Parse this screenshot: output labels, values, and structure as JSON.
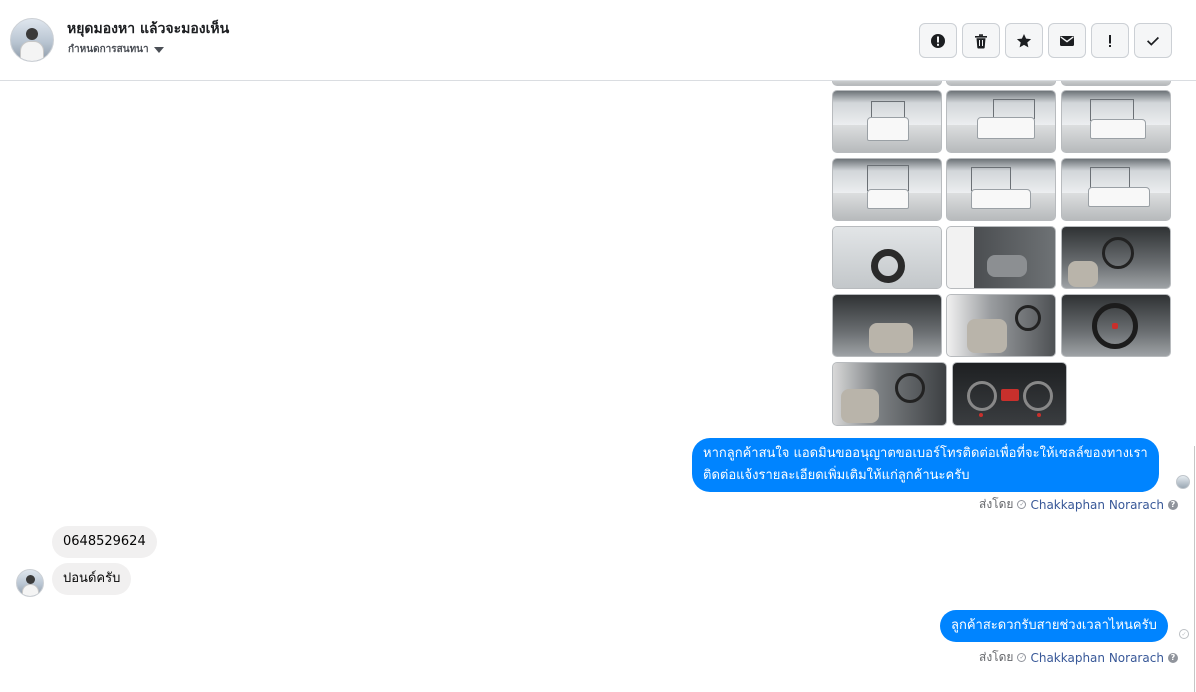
{
  "header": {
    "contact_name": "หยุดมองหา แล้วจะมองเห็น",
    "label_select": "กำหนดการสนทนา"
  },
  "toolbar": {
    "buttons": [
      {
        "name": "report-spam-button",
        "icon": "alert-circle-icon"
      },
      {
        "name": "delete-button",
        "icon": "trash-icon"
      },
      {
        "name": "star-button",
        "icon": "star-icon"
      },
      {
        "name": "mark-unread-button",
        "icon": "envelope-icon"
      },
      {
        "name": "flag-button",
        "icon": "exclamation-icon"
      },
      {
        "name": "mark-done-button",
        "icon": "checkmark-icon"
      }
    ]
  },
  "photos": {
    "count_visible": 17,
    "rows": [
      [
        "truck-rack-top-cropped",
        "truck-rack-top-cropped",
        "truck-rack-top-cropped"
      ],
      [
        "truck-front",
        "truck-front-angle",
        "truck-rear-angle"
      ],
      [
        "truck-rear",
        "truck-side-rear",
        "truck-side"
      ],
      [
        "truck-wheel",
        "truck-door-interior",
        "truck-steering"
      ],
      [
        "truck-gear-shift",
        "truck-seats",
        "truck-steering-close"
      ],
      [
        "truck-cabin-wide",
        "truck-dashboard-gauges"
      ]
    ]
  },
  "messages": [
    {
      "direction": "out",
      "lines": [
        "หากลูกค้าสนใจ แอดมินขออนุญาตขอเบอร์โทรติดต่อเพื่อที่จะให้เซลล์ของทางเรา",
        "ติดต่อแจ้งรายละเอียดเพิ่มเติมให้แก่ลูกค้านะครับ"
      ],
      "sent_by_label": "ส่งโดย",
      "agent": "Chakkaphan Norarach"
    },
    {
      "direction": "in",
      "text": "0648529624"
    },
    {
      "direction": "in",
      "text": "ปอนด์ครับ"
    },
    {
      "direction": "out",
      "text": "ลูกค้าสะดวกรับสายช่วงเวลาไหนครับ",
      "sent_by_label": "ส่งโดย",
      "agent": "Chakkaphan Norarach"
    }
  ],
  "colors": {
    "outgoing_bubble": "#0084ff",
    "incoming_bubble": "#f1f0f0",
    "agent_link": "#385898",
    "meta_text": "#65676b"
  }
}
